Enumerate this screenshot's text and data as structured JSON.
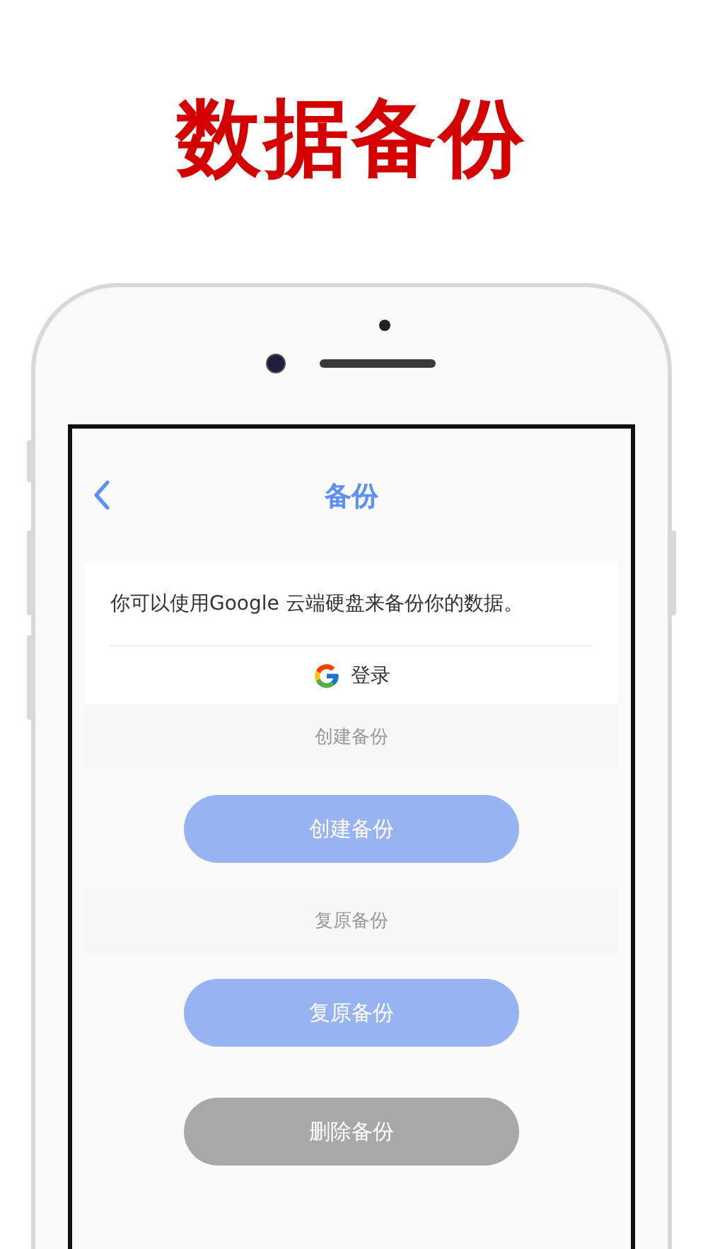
{
  "headline": "数据备份",
  "nav": {
    "title": "备份"
  },
  "google_card": {
    "message": "你可以使用Google 云端硬盘来备份你的数据。",
    "login": "登录"
  },
  "sections": [
    {
      "label": "创建备份",
      "button": {
        "label": "创建备份",
        "kind": "primary",
        "disabled": true
      }
    },
    {
      "label": "复原备份",
      "button": {
        "label": "复原备份",
        "kind": "primary",
        "disabled": true
      }
    },
    {
      "button": {
        "label": "删除备份",
        "kind": "neutral",
        "disabled": true
      }
    }
  ]
}
